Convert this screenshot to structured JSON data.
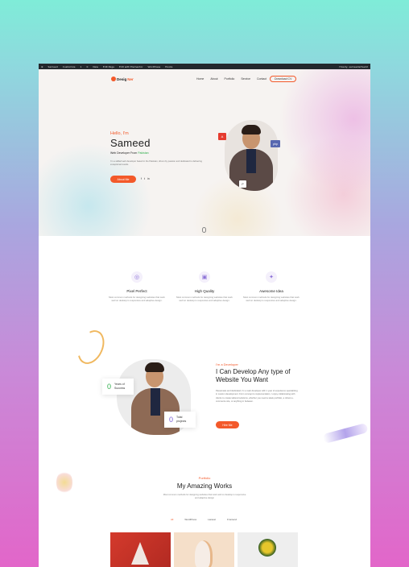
{
  "admin_bar": {
    "items": [
      "Sameed",
      "Customize",
      "1",
      "0",
      "New",
      "Edit Page",
      "Edit with Elementor",
      "WordPress",
      "Hooks",
      "Howdy, sameedarfeed2"
    ]
  },
  "nav": {
    "logo_primary": "Desig",
    "logo_accent": "Ner",
    "items": [
      "Home",
      "About",
      "Portfolio",
      "Service",
      "Contact"
    ],
    "cv_button": "Download CV"
  },
  "hero": {
    "greeting": "Hello, I'm",
    "name": "Sameed",
    "role_prefix": "Web Developer From",
    "role_country": "Pakistan",
    "description": "I'm a skilled web developer based in the Pakistan, driven by passion and dedicated to delivering exceptional results.",
    "about_button": "About Me",
    "socials": [
      "f",
      "t",
      "in"
    ],
    "badge_php": "php",
    "badge_a": "A",
    "badge_b": "P"
  },
  "features": [
    {
      "title": "Pixel Perfect",
      "icon": "target-icon",
      "description": "Most common methods for designing websites that work well on desktop is responsive and adaptive design."
    },
    {
      "title": "High Quality",
      "icon": "brush-icon",
      "description": "Most common methods for designing websites that work well on desktop is responsive and adaptive design."
    },
    {
      "title": "Awesome Idea",
      "icon": "bulb-icon",
      "description": "Most common methods for designing websites that work well on desktop is responsive and adaptive design."
    }
  ],
  "developer": {
    "kicker": "I'm a Developer",
    "title": "I Can Develop Any type of Website You Want",
    "description": "Passionate and dedicated, I'm a web developer with 1 year of experience specializing in custom development. From concept to implementation, I enjoy collaborating with clients to create tailored solutions, whether you need a sleek portfolio, a robust e-commerce site, or anything in between.",
    "hire_button": "Hire Me",
    "stats": [
      {
        "number": "0",
        "label": "Years of Success"
      },
      {
        "number": "0",
        "label": "Total projects"
      }
    ]
  },
  "portfolio": {
    "kicker": "Portfolio",
    "title": "My Amazing Works",
    "description": "Most common methods for designing websites that work well on desktop is responsive and adaptive design",
    "tabs": [
      "All",
      "WordPress",
      "Laravel",
      "Frontend"
    ],
    "active_tab": "All"
  },
  "colors": {
    "accent": "#f3592a",
    "green": "#2fae4b",
    "purple": "#7a5fd6"
  }
}
